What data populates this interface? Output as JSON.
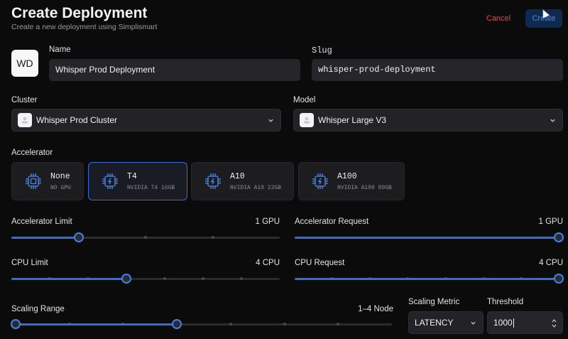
{
  "header": {
    "title": "Create Deployment",
    "subtitle": "Create a new deployment using Simplismart",
    "cancel_label": "Cancel",
    "create_label": "Create"
  },
  "avatar": {
    "initials": "WD"
  },
  "fields": {
    "name_label": "Name",
    "name_value": "Whisper Prod Deployment",
    "slug_label": "Slug",
    "slug_value": "whisper-prod-deployment",
    "cluster_label": "Cluster",
    "cluster_value": "Whisper Prod Cluster",
    "model_label": "Model",
    "model_value": "Whisper Large V3"
  },
  "accelerator": {
    "label": "Accelerator",
    "selected": "T4",
    "options": [
      {
        "name": "None",
        "sub": "NO GPU"
      },
      {
        "name": "T4",
        "sub": "NVIDIA T4 16GB"
      },
      {
        "name": "A10",
        "sub": "NVIDIA A10 22GB"
      },
      {
        "name": "A100",
        "sub": "NVIDIA A100 80GB"
      }
    ]
  },
  "sliders": {
    "accelerator_limit": {
      "label": "Accelerator Limit",
      "value_text": "1 GPU",
      "fraction": 0.25
    },
    "accelerator_request": {
      "label": "Accelerator Request",
      "value_text": "1 GPU",
      "fraction": 1.0
    },
    "cpu_limit": {
      "label": "CPU Limit",
      "value_text": "4 CPU",
      "fraction": 0.4286
    },
    "cpu_request": {
      "label": "CPU Request",
      "value_text": "4 CPU",
      "fraction": 1.0
    },
    "scaling_range": {
      "label": "Scaling Range",
      "value_text": "1–4 Node",
      "min_fraction": 0.0,
      "max_fraction": 0.4286
    }
  },
  "scaling": {
    "metric_label": "Scaling Metric",
    "metric_value": "LATENCY",
    "threshold_label": "Threshold",
    "threshold_value": "1000"
  },
  "colors": {
    "accent": "#2f6fe4",
    "danger": "#e5484d",
    "background": "#0b0b0c"
  }
}
